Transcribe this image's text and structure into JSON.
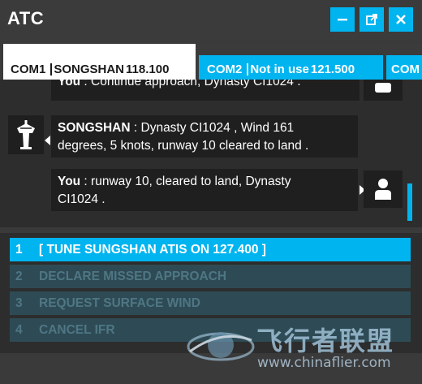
{
  "window": {
    "title": "ATC",
    "buttons": {
      "minimize": "minimize-icon",
      "popout": "popout-icon",
      "close": "close-icon"
    },
    "accent": "#00b4f0"
  },
  "tabs": [
    {
      "label": "COM1",
      "station": "SONGSHAN",
      "frequency": "118.100",
      "active": true
    },
    {
      "label": "COM2",
      "station": "Not in use",
      "frequency": "121.500",
      "active": false
    },
    {
      "label": "COM",
      "station": "",
      "frequency": "",
      "active": false
    }
  ],
  "messages": [
    {
      "speaker": "You",
      "separator": " : ",
      "text": "Continue approach, Dynasty CI1024 ."
    },
    {
      "speaker": "SONGSHAN",
      "separator": " : ",
      "line1": "Dynasty CI1024 , Wind 161",
      "line2": "degrees, 5 knots, runway 10 cleared to land ."
    },
    {
      "speaker": "You",
      "separator": " : ",
      "line1": "runway 10, cleared to land, Dynasty",
      "line2": "CI1024 ."
    }
  ],
  "options": [
    {
      "num": "1",
      "label": "[ TUNE SUNGSHAN ATIS ON 127.400 ]",
      "selected": true
    },
    {
      "num": "2",
      "label": "DECLARE MISSED APPROACH",
      "selected": false
    },
    {
      "num": "3",
      "label": "REQUEST SURFACE WIND",
      "selected": false
    },
    {
      "num": "4",
      "label": "CANCEL IFR",
      "selected": false
    }
  ],
  "watermark": {
    "name": "飞行者联盟",
    "url": "www.chinaflier.com"
  }
}
